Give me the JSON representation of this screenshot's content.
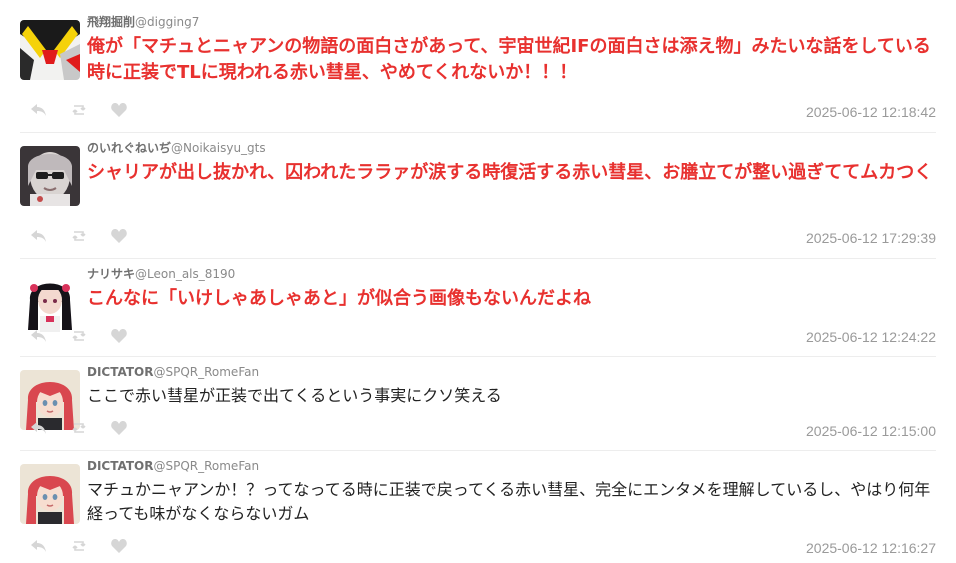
{
  "posts": [
    {
      "name": "飛翔掘削",
      "handle": "@digging7",
      "text": "俺が「マチュとニャアンの物語の面白さがあって、宇宙世紀IFの面白さは添え物」みたいな話をしている時に正装でTLに現われる赤い彗星、やめてくれないか！！！",
      "time": "2025-06-12 12:18:42",
      "avatar": "mecha-avatar"
    },
    {
      "name": "のいれぐねいぢ",
      "handle": "@Noikaisyu_gts",
      "text": "シャリアが出し抜かれ、囚われたララァが涙する時復活する赤い彗星、お膳立てが整い過ぎててムカつく",
      "time": "2025-06-12 17:29:39",
      "avatar": "sunglasses-avatar"
    },
    {
      "name": "ナリサキ",
      "handle": "@Leon_als_8190",
      "text": "こんなに「いけしゃあしゃあと」が似合う画像もないんだよね",
      "time": "2025-06-12 12:24:22",
      "avatar": "girl-avatar"
    },
    {
      "name": "DICTATOR",
      "handle": "@SPQR_RomeFan",
      "text": "ここで赤い彗星が正装で出てくるという事実にクソ笑える",
      "time": "2025-06-12 12:15:00",
      "avatar": "redhair-avatar"
    },
    {
      "name": "DICTATOR",
      "handle": "@SPQR_RomeFan",
      "text": "マチュかニャアンか！？ってなってる時に正装で戻ってくる赤い彗星、完全にエンタメを理解しているし、やはり何年経っても味がなくならないガム",
      "time": "2025-06-12 12:16:27",
      "avatar": "redhair-avatar"
    }
  ],
  "icons": {
    "reply": "reply-icon",
    "retweet": "retweet-icon",
    "like": "heart-icon"
  },
  "colors": {
    "highlight_text": "#e8312f",
    "normal_text": "#222222",
    "meta_text": "#7a7a7a",
    "time_text": "#9a9a9a",
    "action_icon": "#d6d6d6"
  }
}
